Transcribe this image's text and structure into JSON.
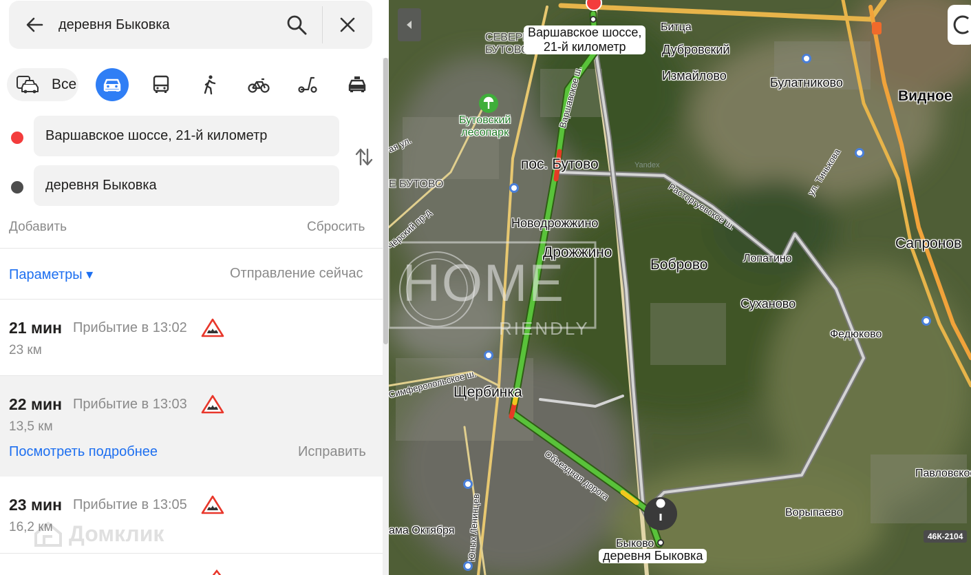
{
  "search": {
    "query": "деревня Быковка"
  },
  "modes": {
    "all_label": "Все"
  },
  "points": {
    "from": "Варшавское шоссе, 21-й километр",
    "to": "деревня Быковка",
    "from_color": "#f33c3c",
    "to_color": "#4d4d4d"
  },
  "actions": {
    "add": "Добавить",
    "reset": "Сбросить"
  },
  "options": {
    "params": "Параметры ▾",
    "departure": "Отправление сейчас"
  },
  "routes": [
    {
      "time": "21 мин",
      "arrival": "Прибытие в 13:02",
      "distance": "23 км"
    },
    {
      "time": "22 мин",
      "arrival": "Прибытие в 13:03",
      "distance": "13,5 км",
      "details": "Посмотреть подробнее",
      "fix": "Исправить"
    },
    {
      "time": "23 мин",
      "arrival": "Прибытие в 13:05",
      "distance": "16,2 км"
    }
  ],
  "watermarks": {
    "domclick": "Домклик",
    "home": "HOME",
    "friendly": "RIENDLY"
  },
  "map": {
    "start_label": "Варшавское шоссе,\n21-й километр",
    "end_label": "деревня Быковка",
    "places": {
      "severnoe_butovo": "СЕВЕРНОЕ\nБУТОВО",
      "bitsa": "Битца",
      "dubrovsky": "Дубровский",
      "izmaylovo": "Измайлово",
      "bulatnikovo": "Булатниково",
      "vidnoe": "Видное",
      "butovsky_les": "Бутовский\nлесопарк",
      "pos_butovo": "пос. Бутово",
      "yuzhnoe_butovo": "Е БУТОВО",
      "novodrozhzhino": "Новодрожжино",
      "drozhzhino": "Дрожжино",
      "bobrovo": "Боброво",
      "lopatino": "Лопатино",
      "sapronovo": "Сапронов",
      "sukhanovo": "Суханово",
      "fedyukovo": "Федюково",
      "shcherbinka": "Щербинка",
      "pavlovskoe": "Павловское",
      "vorypaevo": "Ворыпаево",
      "oktyabrya": "ама Октября",
      "bykovo": "Быково"
    },
    "roads": {
      "varshavskoe": "Варшавское ш.",
      "rastorguevskoe": "Расторгуевское ш.",
      "tinkova": "ул. Тинькова",
      "obyezdnaya": "Объездная дорога",
      "yunyh_lenintsev": "Юных Ленинцев",
      "tserkovny": "Чёрский пр-д",
      "simferopolskoe": "Симферопольское ш.",
      "left_ul": "ая ул."
    },
    "highway_badge": "46К-2104",
    "yandex_mark": "Yandex"
  }
}
